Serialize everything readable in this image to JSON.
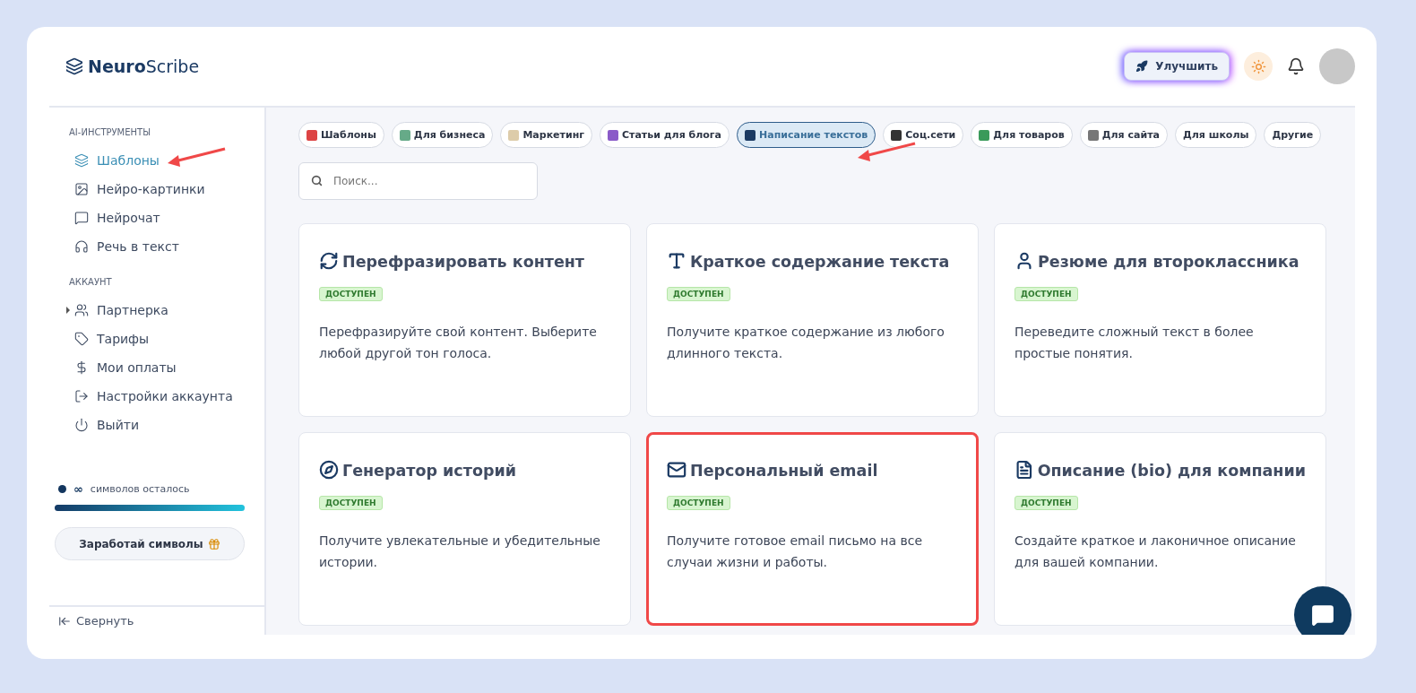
{
  "logo": {
    "strong": "Neuro",
    "light": "Scribe"
  },
  "header": {
    "upgrade_button": "Улучшить"
  },
  "sidebar": {
    "sections": [
      {
        "title": "AI-ИНСТРУМЕНТЫ",
        "items": [
          {
            "label": "Шаблоны",
            "selected": true
          },
          {
            "label": "Нейро-картинки",
            "selected": false
          },
          {
            "label": "Нейрочат",
            "selected": false
          },
          {
            "label": "Речь в текст",
            "selected": false
          }
        ]
      },
      {
        "title": "АККАУНТ",
        "items": [
          {
            "label": "Партнерка",
            "selected": false,
            "expandable": true
          },
          {
            "label": "Тарифы",
            "selected": false,
            "expandable": false
          },
          {
            "label": "Мои оплаты",
            "selected": false,
            "expandable": false
          },
          {
            "label": "Настройки аккаунта",
            "selected": false,
            "expandable": false
          },
          {
            "label": "Выйти",
            "selected": false,
            "expandable": false
          }
        ]
      }
    ],
    "credits": {
      "amount": "∞",
      "label": "символов осталось",
      "level": 1
    },
    "earn_button": "Заработай символы",
    "collapse": "Свернуть"
  },
  "categories": [
    {
      "label": "Шаблоны",
      "selected": false
    },
    {
      "label": "Для бизнеса",
      "selected": false
    },
    {
      "label": "Маркетинг",
      "selected": false
    },
    {
      "label": "Статьи для блога",
      "selected": false
    },
    {
      "label": "Написание текстов",
      "selected": true
    },
    {
      "label": "Соц.сети",
      "selected": false
    },
    {
      "label": "Для товаров",
      "selected": false
    },
    {
      "label": "Для сайта",
      "selected": false
    },
    {
      "label": "Для школы",
      "selected": false
    },
    {
      "label": "Другие",
      "selected": false
    }
  ],
  "search": {
    "placeholder": "Поиск..."
  },
  "annotations": [
    {
      "kind": "arrow"
    },
    {
      "kind": "arrow"
    }
  ],
  "cards": [
    {
      "title": "Перефразировать контент",
      "badge": "ДОСТУПЕН",
      "description": "Перефразируйте свой контент. Выберите любой другой тон голоса.",
      "highlighted": false
    },
    {
      "title": "Краткое содержание текста",
      "badge": "ДОСТУПЕН",
      "description": "Получите краткое содержание из любого длинного текста.",
      "highlighted": false
    },
    {
      "title": "Резюме для второклассника",
      "badge": "ДОСТУПЕН",
      "description": "Переведите сложный текст в более простые понятия.",
      "highlighted": false
    },
    {
      "title": "Генератор историй",
      "badge": "ДОСТУПЕН",
      "description": "Получите увлекательные и убедительные истории.",
      "highlighted": false
    },
    {
      "title": "Персональный email",
      "badge": "ДОСТУПЕН",
      "description": "Получите готовое email письмо на все случаи жизни и работы.",
      "highlighted": true
    },
    {
      "title": "Описание (bio) для компании",
      "badge": "ДОСТУПЕН",
      "description": "Создайте краткое и лаконичное описание для вашей компании.",
      "highlighted": false
    }
  ]
}
